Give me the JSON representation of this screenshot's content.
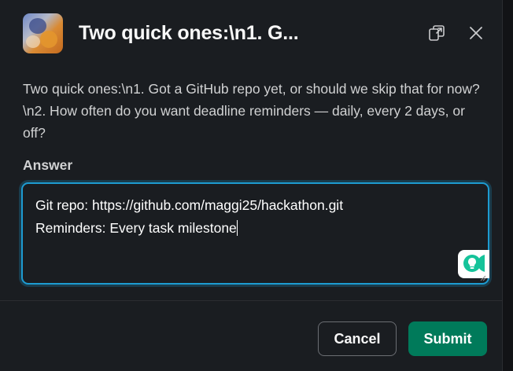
{
  "header": {
    "title": "Two quick ones:\\n1. G..."
  },
  "question": {
    "text": "Two quick ones:\\n1. Got a GitHub repo yet, or should we skip that for now?\\n2. How often do you want deadline reminders — daily, every 2 days, or off?"
  },
  "answer": {
    "label": "Answer",
    "line1": "Git repo: https://github.com/maggi25/hackathon.git",
    "line2": "Reminders: Every task milestone"
  },
  "buttons": {
    "cancel": "Cancel",
    "submit": "Submit"
  },
  "icons": {
    "popout": "popout-icon",
    "close": "close-icon",
    "grammarly": "grammarly-icon"
  },
  "colors": {
    "background": "#1a1d21",
    "focus_ring": "#1d9bd1",
    "submit": "#007a5a"
  }
}
